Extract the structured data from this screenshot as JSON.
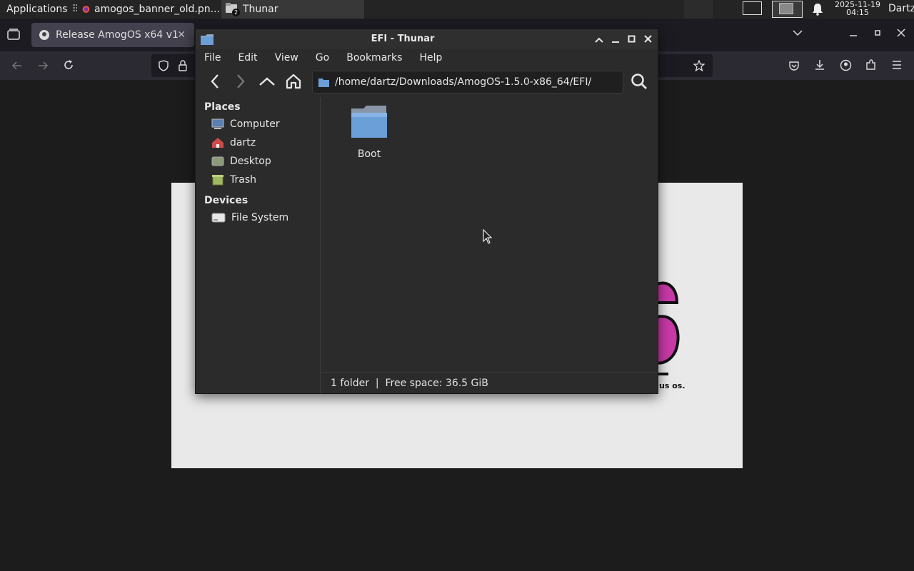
{
  "panel": {
    "applications_label": "Applications",
    "tasks": [
      {
        "label": "amogos_banner_old.pn..."
      },
      {
        "label": "Thunar"
      }
    ],
    "date": "2025-11-19",
    "time": "04:15",
    "user": "Dartz",
    "thunar_badge": "2"
  },
  "firefox": {
    "tab_label": "Release AmogOS x64 v1",
    "tab_close": "✕",
    "banner_caption": "us os."
  },
  "thunar": {
    "title": "EFI - Thunar",
    "menu": [
      "File",
      "Edit",
      "View",
      "Go",
      "Bookmarks",
      "Help"
    ],
    "path": "/home/dartz/Downloads/AmogOS-1.5.0-x86_64/EFI/",
    "places_heading": "Places",
    "places": [
      {
        "label": "Computer",
        "icon": "computer-icon"
      },
      {
        "label": "dartz",
        "icon": "home-folder-icon"
      },
      {
        "label": "Desktop",
        "icon": "desktop-icon"
      },
      {
        "label": "Trash",
        "icon": "trash-icon"
      }
    ],
    "devices_heading": "Devices",
    "devices": [
      {
        "label": "File System",
        "icon": "drive-icon"
      }
    ],
    "files": [
      {
        "label": "Boot",
        "icon": "folder-icon"
      }
    ],
    "status": "1 folder  |  Free space: 36.5 GiB"
  },
  "colors": {
    "accent_blue": "#6a9fd8",
    "banner_magenta": "#c93aa8"
  }
}
